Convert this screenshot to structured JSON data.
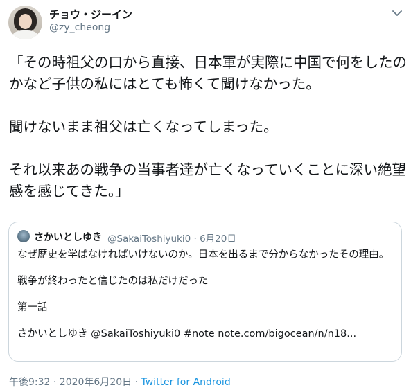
{
  "author": {
    "name": "チョウ・ジーイン",
    "handle": "@zy_cheong"
  },
  "tweet": {
    "text": "「その時祖父の口から直接、日本軍が実際に中国で何をしたのかなど子供の私にはとても怖くて聞けなかった。\n\n聞けないまま祖父は亡くなってしまった。\n\nそれ以来あの戦争の当事者達が亡くなっていくことに深い絶望感を感じてきた。」"
  },
  "quoted_tweet": {
    "author_name": "さかいとしゆき",
    "meta": "@SakaiToshiyuki0 · 6月20日",
    "text": "なぜ歴史を学ばなければいけないのか。日本を出るまで分からなかったその理由。\n\n戦争が終わったと信じたのは私だけだった\n\n第一話\n\nさかいとしゆき @SakaiToshiyuki0 #note note.com/bigocean/n/n18..."
  },
  "footer": {
    "timestamp": "午後9:32 · 2020年6月20日 · ",
    "source": "Twitter for Android"
  },
  "icons": {
    "menu": "chevron-down-icon"
  },
  "colors": {
    "text_primary": "#14171a",
    "text_secondary": "#657786",
    "link": "#1b95e0",
    "border": "#ccd6dd"
  }
}
